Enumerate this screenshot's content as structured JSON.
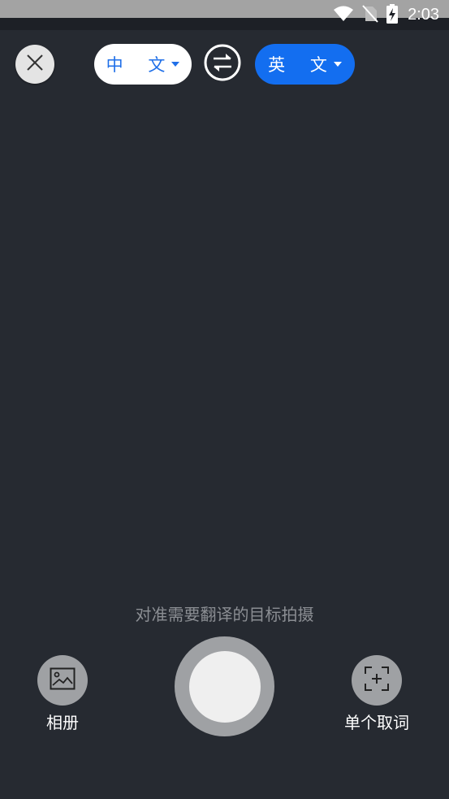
{
  "status_bar": {
    "time": "2:03",
    "icons": [
      "wifi-icon",
      "no-sim-icon",
      "battery-charging-icon"
    ]
  },
  "toolbar": {
    "close_icon": "close-icon",
    "source_language": "中 文",
    "target_language": "英 文",
    "swap_icon": "swap-icon"
  },
  "camera": {
    "hint": "对准需要翻译的目标拍摄"
  },
  "bottom_bar": {
    "album_label": "相册",
    "single_word_label": "单个取词"
  },
  "colors": {
    "background": "#262a31",
    "accent": "#136ef0",
    "button_gray": "#9fa1a4"
  }
}
